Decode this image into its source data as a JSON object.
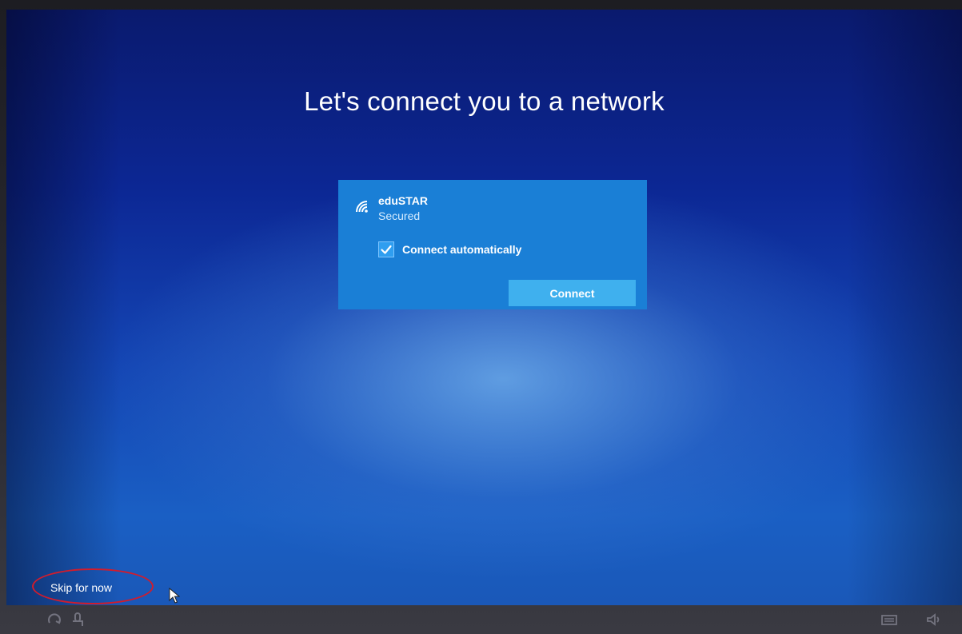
{
  "setup": {
    "title": "Let's connect you to a network"
  },
  "network": {
    "name": "eduSTAR",
    "status": "Secured",
    "connect_automatically_label": "Connect automatically",
    "connect_automatically_checked": true,
    "connect_button_label": "Connect",
    "signal_icon": "wifi-icon"
  },
  "footer": {
    "skip_label": "Skip for now",
    "bottom_icons": [
      "ease-of-access-icon",
      "accessibility-icon",
      "keyboard-icon",
      "volume-icon"
    ]
  },
  "colors": {
    "card": "#1a7fd6",
    "button": "#3fb0ee",
    "highlight_circle": "#d21c2c",
    "background_top": "#0a1a6e",
    "background_bottom": "#1a5fc4"
  }
}
